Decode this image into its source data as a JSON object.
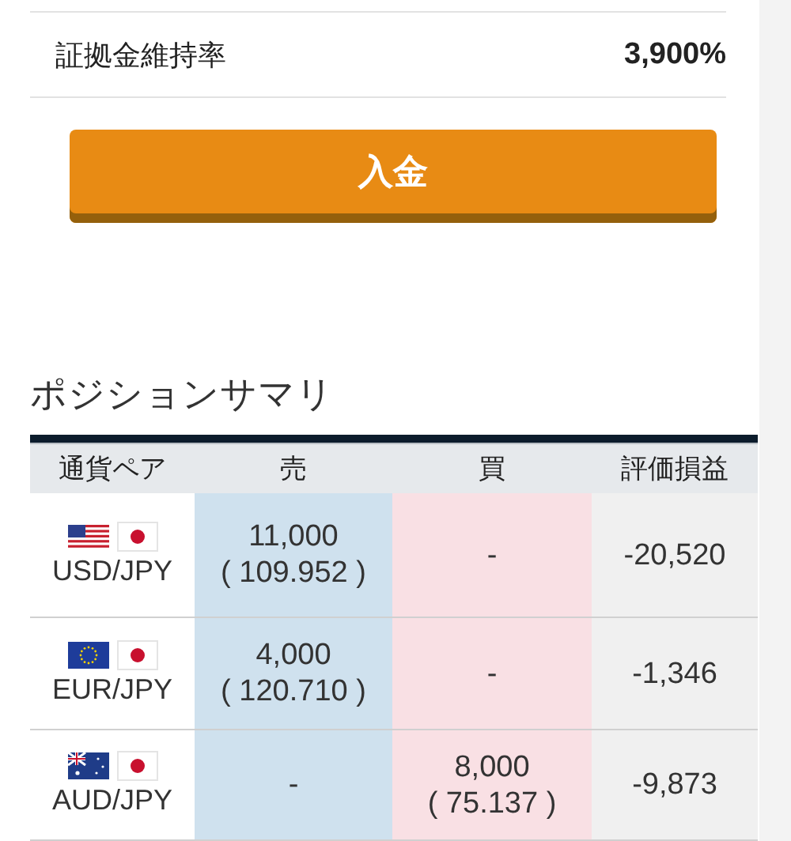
{
  "margin_row": {
    "label": "証拠金維持率",
    "value": "3,900%"
  },
  "deposit_button": {
    "label": "入金"
  },
  "position_summary": {
    "title": "ポジションサマリ",
    "columns": [
      "通貨ペア",
      "売",
      "買",
      "評価損益"
    ],
    "rows": [
      {
        "pair": "USD/JPY",
        "flags": [
          {
            "kind": "us"
          },
          {
            "kind": "jp"
          }
        ],
        "sell": [
          "11,000",
          "( 109.952 )"
        ],
        "buy": [
          "-"
        ],
        "pl": "-20,520"
      },
      {
        "pair": "EUR/JPY",
        "flags": [
          {
            "kind": "eu"
          },
          {
            "kind": "jp"
          }
        ],
        "sell": [
          "4,000",
          "( 120.710 )"
        ],
        "buy": [
          "-"
        ],
        "pl": "-1,346"
      },
      {
        "pair": "AUD/JPY",
        "flags": [
          {
            "kind": "au"
          },
          {
            "kind": "jp"
          }
        ],
        "sell": [
          "-"
        ],
        "buy": [
          "8,000",
          "( 75.137 )"
        ],
        "pl": "-9,873"
      }
    ]
  }
}
